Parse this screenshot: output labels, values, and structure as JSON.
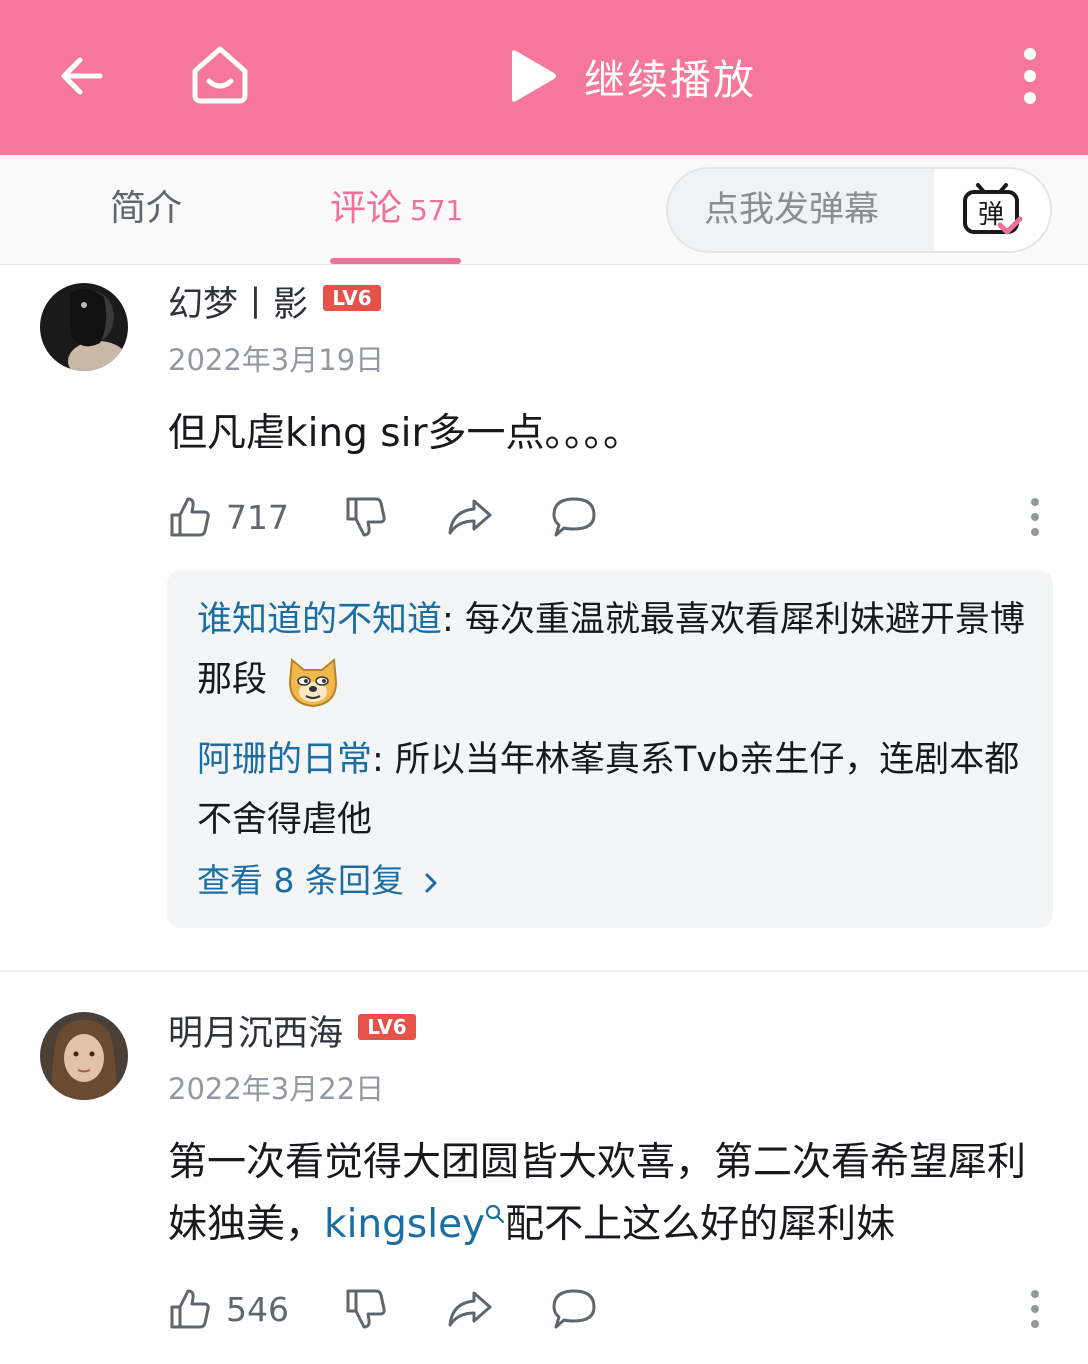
{
  "topbar": {
    "continue_label": "继续播放",
    "icons": [
      "arrow-left-icon",
      "home-icon",
      "play-icon",
      "more-vertical-icon"
    ]
  },
  "tabs": {
    "intro": "简介",
    "comments": "评论",
    "comments_count": "571",
    "danmu_placeholder": "点我发弹幕",
    "danmu_icon_text": "弹"
  },
  "comments": [
    {
      "username": "幻梦丨影",
      "level": "LV6",
      "date": "2022年3月19日",
      "content": "但凡虐king sir多一点。。。。",
      "likes": "717",
      "replies": [
        {
          "user": "谁知道的不知道",
          "text": ": 每次重温就最喜欢看犀利妹避开景博那段"
        },
        {
          "user": "阿珊的日常",
          "text": ": 所以当年林峯真系Tvb亲生仔，连剧本都不舍得虐他"
        }
      ],
      "see_more": "查看 8 条回复"
    },
    {
      "username": "明月沉西海",
      "level": "LV6",
      "date": "2022年3月22日",
      "content_before": "第一次看觉得大团圆皆大欢喜，第二次看希望犀利妹独美，",
      "mention": "kingsley",
      "content_after": "配不上这么好的犀利妹",
      "likes": "546"
    }
  ],
  "colors": {
    "brand_pink": "#f5779b",
    "accent_pink": "#f0709a",
    "link_blue": "#1b6ea3",
    "level_red": "#e6524a"
  }
}
